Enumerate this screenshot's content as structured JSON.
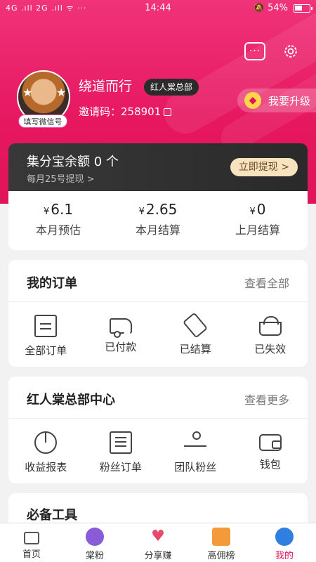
{
  "status": {
    "left": "4G .ıll 2G .ıll ᯤ ···",
    "time": "14:44",
    "right": "🔕 54%",
    "battery_level": 0.54
  },
  "header": {
    "icons": [
      "message-icon",
      "gear-icon"
    ]
  },
  "profile": {
    "wx_badge": "填写微信号",
    "nickname": "绕道而行",
    "role_tag": "红人棠总部",
    "invite": "邀请码：258901",
    "upgrade": "我要升级"
  },
  "collect": {
    "title": "集分宝余额 0 个",
    "sub": "每月25号提现 >",
    "withdraw": "立即提现 >"
  },
  "earn": [
    {
      "yen": "¥",
      "value": "6.1",
      "label": "本月预估"
    },
    {
      "yen": "¥",
      "value": "2.65",
      "label": "本月结算"
    },
    {
      "yen": "¥",
      "value": "0",
      "label": "上月结算"
    }
  ],
  "orders": {
    "title": "我的订单",
    "more": "查看全部",
    "items": [
      "全部订单",
      "已付款",
      "已结算",
      "已失效"
    ]
  },
  "center": {
    "title": "红人棠总部中心",
    "more": "查看更多",
    "items": [
      "收益报表",
      "粉丝订单",
      "团队粉丝",
      "钱包"
    ]
  },
  "tools": {
    "title": "必备工具"
  },
  "tabs": [
    "首页",
    "棠粉",
    "分享赚",
    "高佣榜",
    "我的"
  ],
  "colors": {
    "accent": "#e0145a",
    "dark_card": "#2a2a2a",
    "withdraw_btn": "#f8e3c1"
  }
}
